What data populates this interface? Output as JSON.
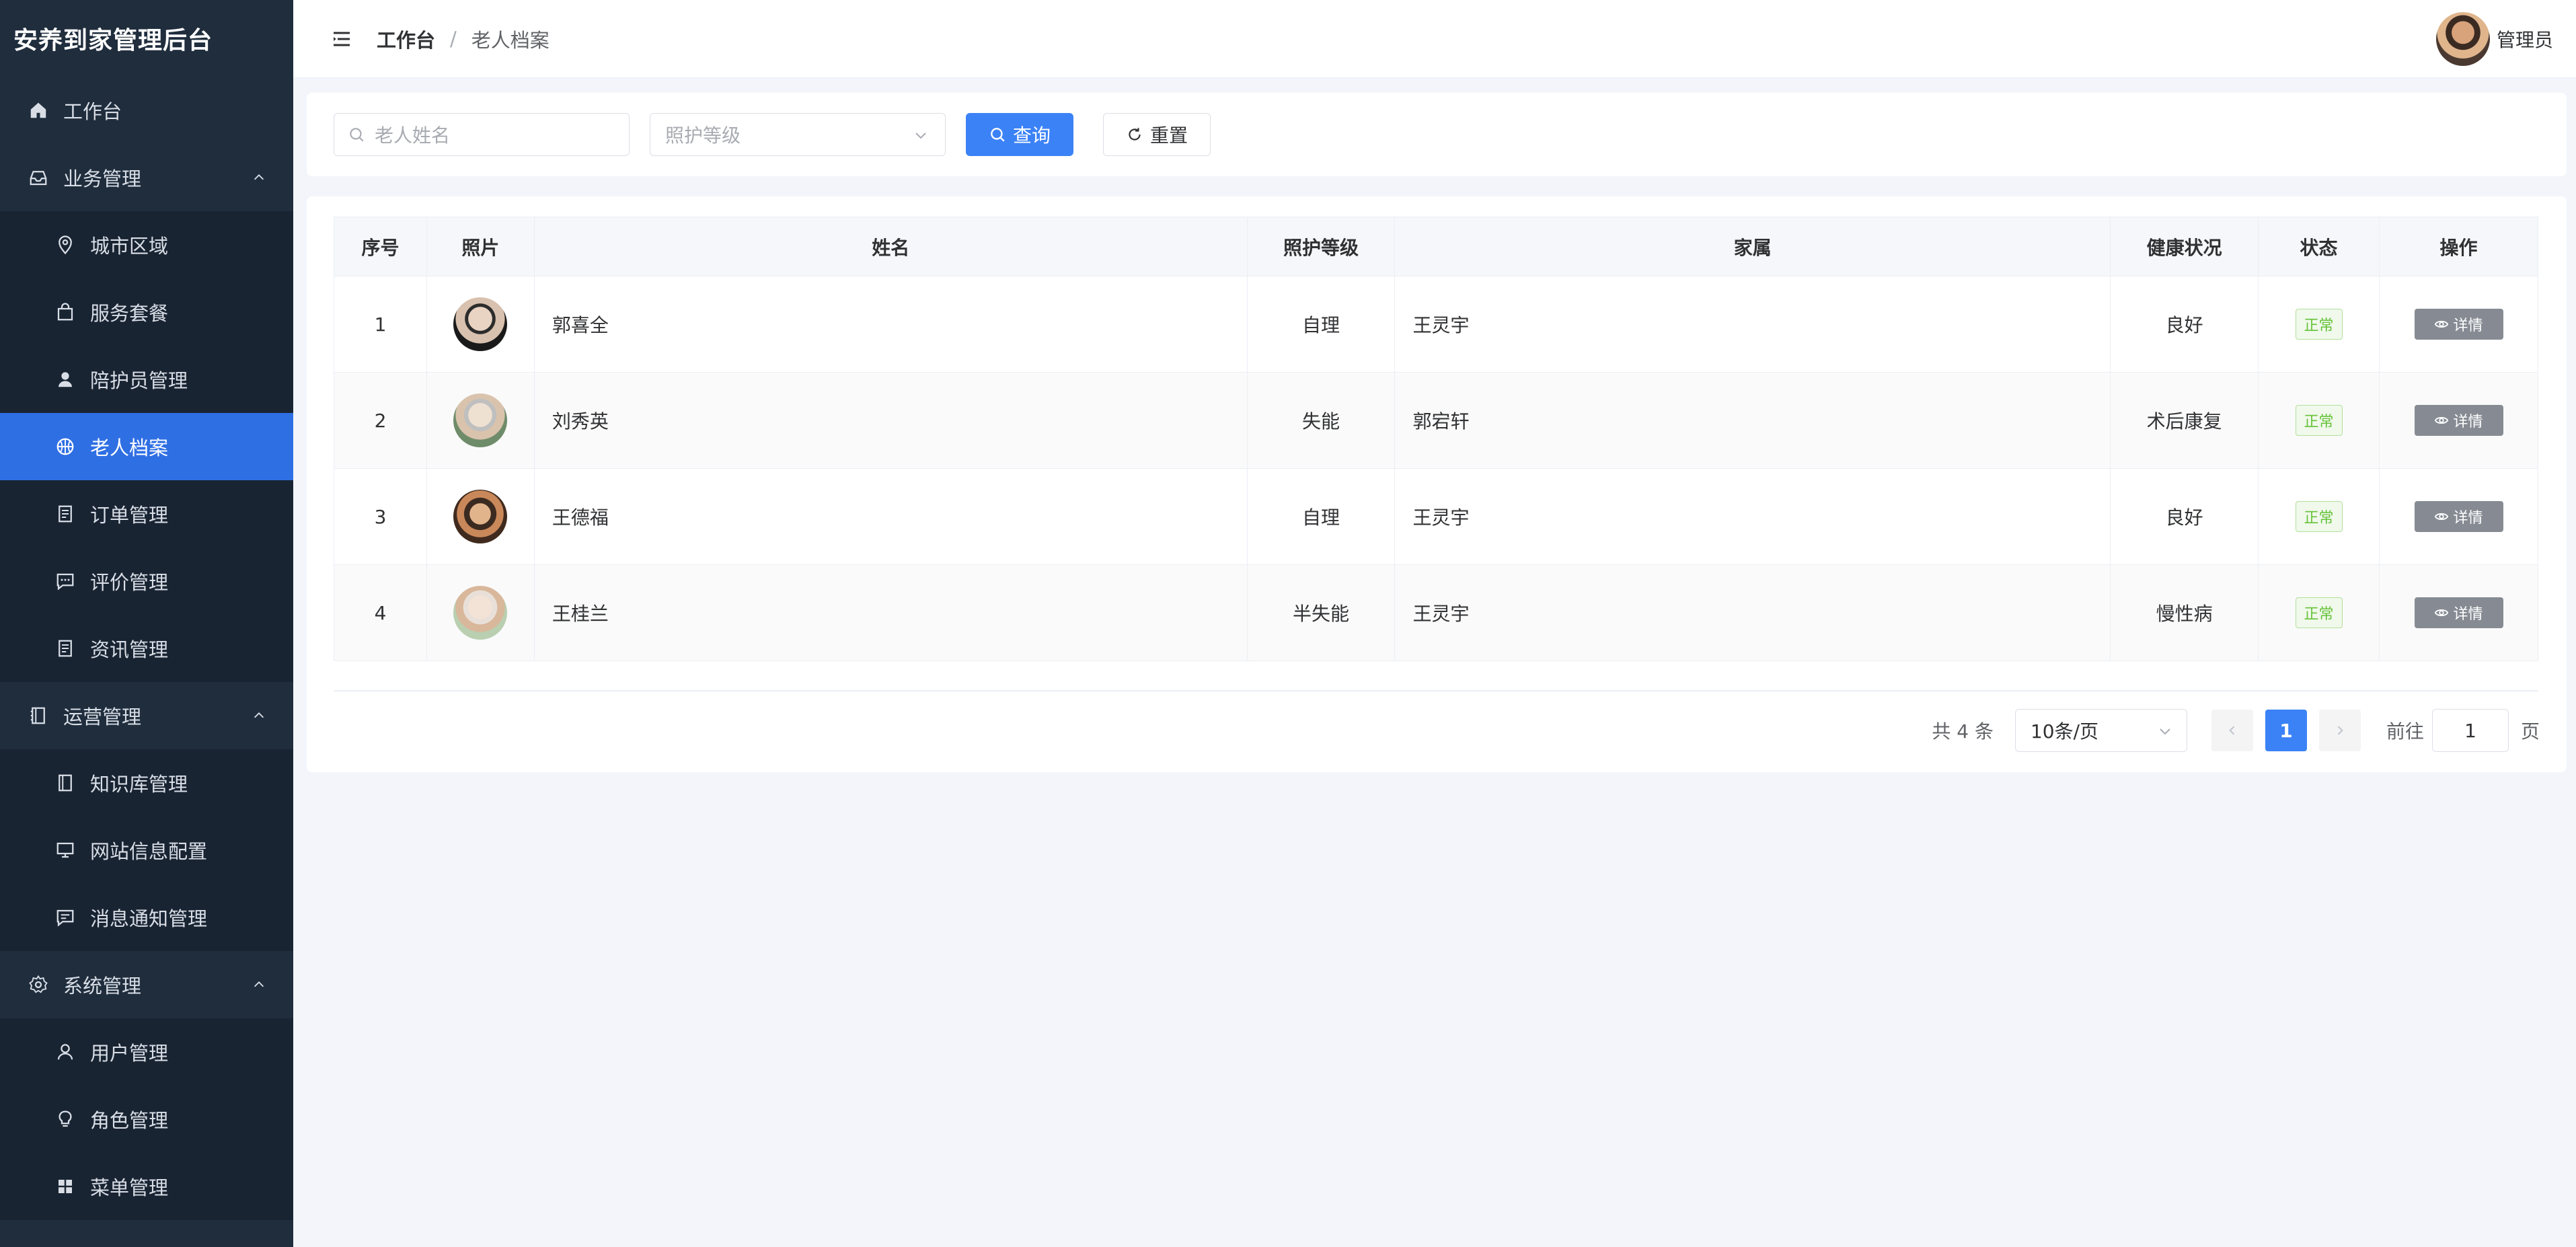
{
  "app": {
    "title": "安养到家管理后台"
  },
  "colors": {
    "sidebar_bg": "#1f2d3d",
    "accent": "#2f6fe4",
    "primary_button": "#3b82f6",
    "status_green": "#67c23a"
  },
  "sidebar": {
    "items": [
      {
        "label": "工作台",
        "icon": "home-icon"
      },
      {
        "label": "业务管理",
        "icon": "inbox-icon",
        "expanded": true
      },
      {
        "label": "城市区域",
        "icon": "location-icon"
      },
      {
        "label": "服务套餐",
        "icon": "bag-icon"
      },
      {
        "label": "陪护员管理",
        "icon": "user-solid-icon"
      },
      {
        "label": "老人档案",
        "icon": "basketball-icon",
        "active": true
      },
      {
        "label": "订单管理",
        "icon": "document-icon"
      },
      {
        "label": "评价管理",
        "icon": "chat-icon"
      },
      {
        "label": "资讯管理",
        "icon": "document-icon"
      },
      {
        "label": "运营管理",
        "icon": "notebook-icon",
        "expanded": true
      },
      {
        "label": "知识库管理",
        "icon": "notebook-icon"
      },
      {
        "label": "网站信息配置",
        "icon": "monitor-icon"
      },
      {
        "label": "消息通知管理",
        "icon": "message-icon"
      },
      {
        "label": "系统管理",
        "icon": "gear-icon",
        "expanded": true
      },
      {
        "label": "用户管理",
        "icon": "user-icon"
      },
      {
        "label": "角色管理",
        "icon": "bulb-icon"
      },
      {
        "label": "菜单管理",
        "icon": "grid-icon"
      }
    ]
  },
  "header": {
    "breadcrumb_root": "工作台",
    "breadcrumb_sep": "/",
    "breadcrumb_current": "老人档案",
    "user_name": "管理员"
  },
  "search": {
    "name_placeholder": "老人姓名",
    "level_placeholder": "照护等级",
    "query_label": "查询",
    "reset_label": "重置"
  },
  "table": {
    "columns": [
      "序号",
      "照片",
      "姓名",
      "照护等级",
      "家属",
      "健康状况",
      "状态",
      "操作"
    ],
    "rows": [
      {
        "index": "1",
        "name": "郭喜全",
        "level": "自理",
        "family": "王灵宇",
        "health": "良好",
        "status": "正常",
        "action": "详情"
      },
      {
        "index": "2",
        "name": "刘秀英",
        "level": "失能",
        "family": "郭宕轩",
        "health": "术后康复",
        "status": "正常",
        "action": "详情"
      },
      {
        "index": "3",
        "name": "王德福",
        "level": "自理",
        "family": "王灵宇",
        "health": "良好",
        "status": "正常",
        "action": "详情"
      },
      {
        "index": "4",
        "name": "王桂兰",
        "level": "半失能",
        "family": "王灵宇",
        "health": "慢性病",
        "status": "正常",
        "action": "详情"
      }
    ]
  },
  "pagination": {
    "total_text": "共 4 条",
    "page_size": "10条/页",
    "current_page": "1",
    "goto_label": "前往",
    "goto_value": "1",
    "page_suffix": "页"
  }
}
